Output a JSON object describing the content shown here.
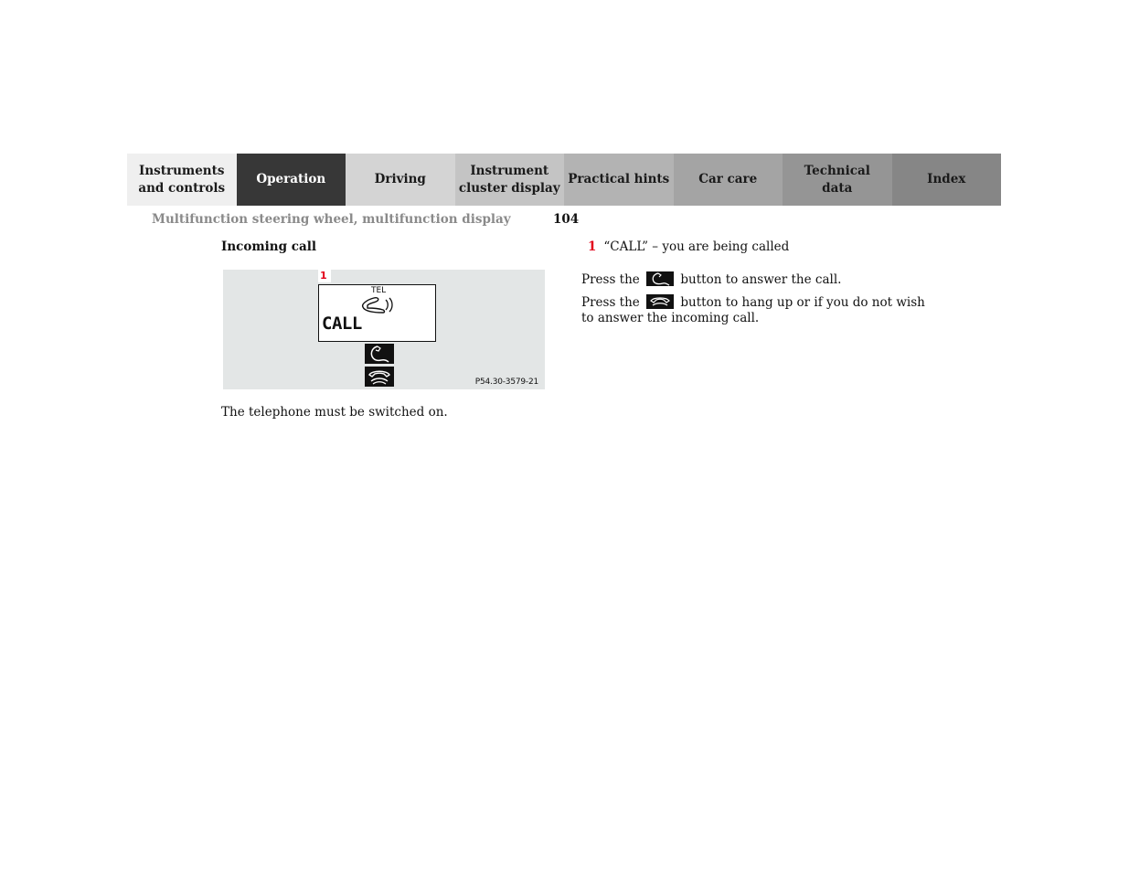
{
  "nav": {
    "tabs": [
      {
        "label": "Instruments\nand controls",
        "line1": "Instruments",
        "line2": "and controls"
      },
      {
        "label": "Operation",
        "active": true
      },
      {
        "label": "Driving"
      },
      {
        "label": "Instrument\ncluster display",
        "line1": "Instrument",
        "line2": "cluster display"
      },
      {
        "label": "Practical hints"
      },
      {
        "label": "Car care"
      },
      {
        "label": "Technical\ndata",
        "line1": "Technical",
        "line2": "data"
      },
      {
        "label": "Index"
      }
    ]
  },
  "header": {
    "running_head": "Multifunction steering wheel, multifunction display",
    "page_number": "104"
  },
  "section": {
    "title": "Incoming call"
  },
  "figure": {
    "callout": "1",
    "display_label_top": "TEL",
    "display_text": "CALL",
    "answer_button_icon": "phone-answer-icon",
    "hangup_button_icon": "phone-hangup-icon",
    "reference": "P54.30-3579-21"
  },
  "note": "The telephone must be switched on.",
  "legend": {
    "items": [
      {
        "number": "1",
        "text": "“CALL” – you are being called"
      }
    ]
  },
  "instructions": {
    "answer": {
      "before": "Press the",
      "after": "button to answer the call."
    },
    "hangup": {
      "before": "Press the",
      "after_line1": "button to hang up or if you do not wish",
      "after_line2": "to answer the incoming call."
    }
  },
  "colors": {
    "accent_red": "#e2001a",
    "active_tab": "#373737",
    "figure_bg": "#e3e6e6"
  }
}
